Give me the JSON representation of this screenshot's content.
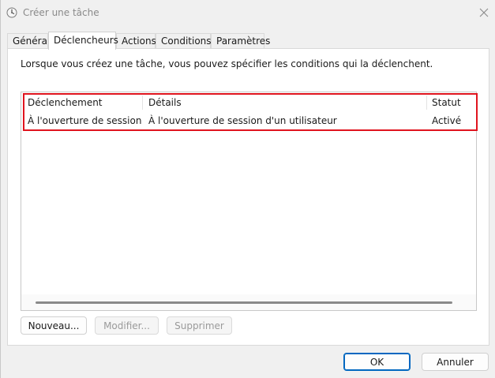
{
  "window": {
    "title": "Créer une tâche",
    "icons": {
      "app": "clock-icon",
      "close": "close-icon"
    }
  },
  "tabs": [
    {
      "label": "Général",
      "active": false
    },
    {
      "label": "Déclencheurs",
      "active": true
    },
    {
      "label": "Actions",
      "active": false
    },
    {
      "label": "Conditions",
      "active": false
    },
    {
      "label": "Paramètres",
      "active": false
    }
  ],
  "triggers": {
    "description": "Lorsque vous créez une tâche, vous pouvez spécifier les conditions qui la déclenchent.",
    "columns": [
      "Déclenchement",
      "Détails",
      "Statut"
    ],
    "rows": [
      {
        "trigger": "À l'ouverture de session",
        "details": "À l'ouverture de session d'un utilisateur",
        "status": "Activé"
      }
    ],
    "buttons": {
      "new": "Nouveau...",
      "edit": "Modifier...",
      "delete": "Supprimer"
    }
  },
  "footer": {
    "ok": "OK",
    "cancel": "Annuler"
  },
  "colors": {
    "highlight": "#e0141e",
    "default_button_border": "#0067c0"
  }
}
